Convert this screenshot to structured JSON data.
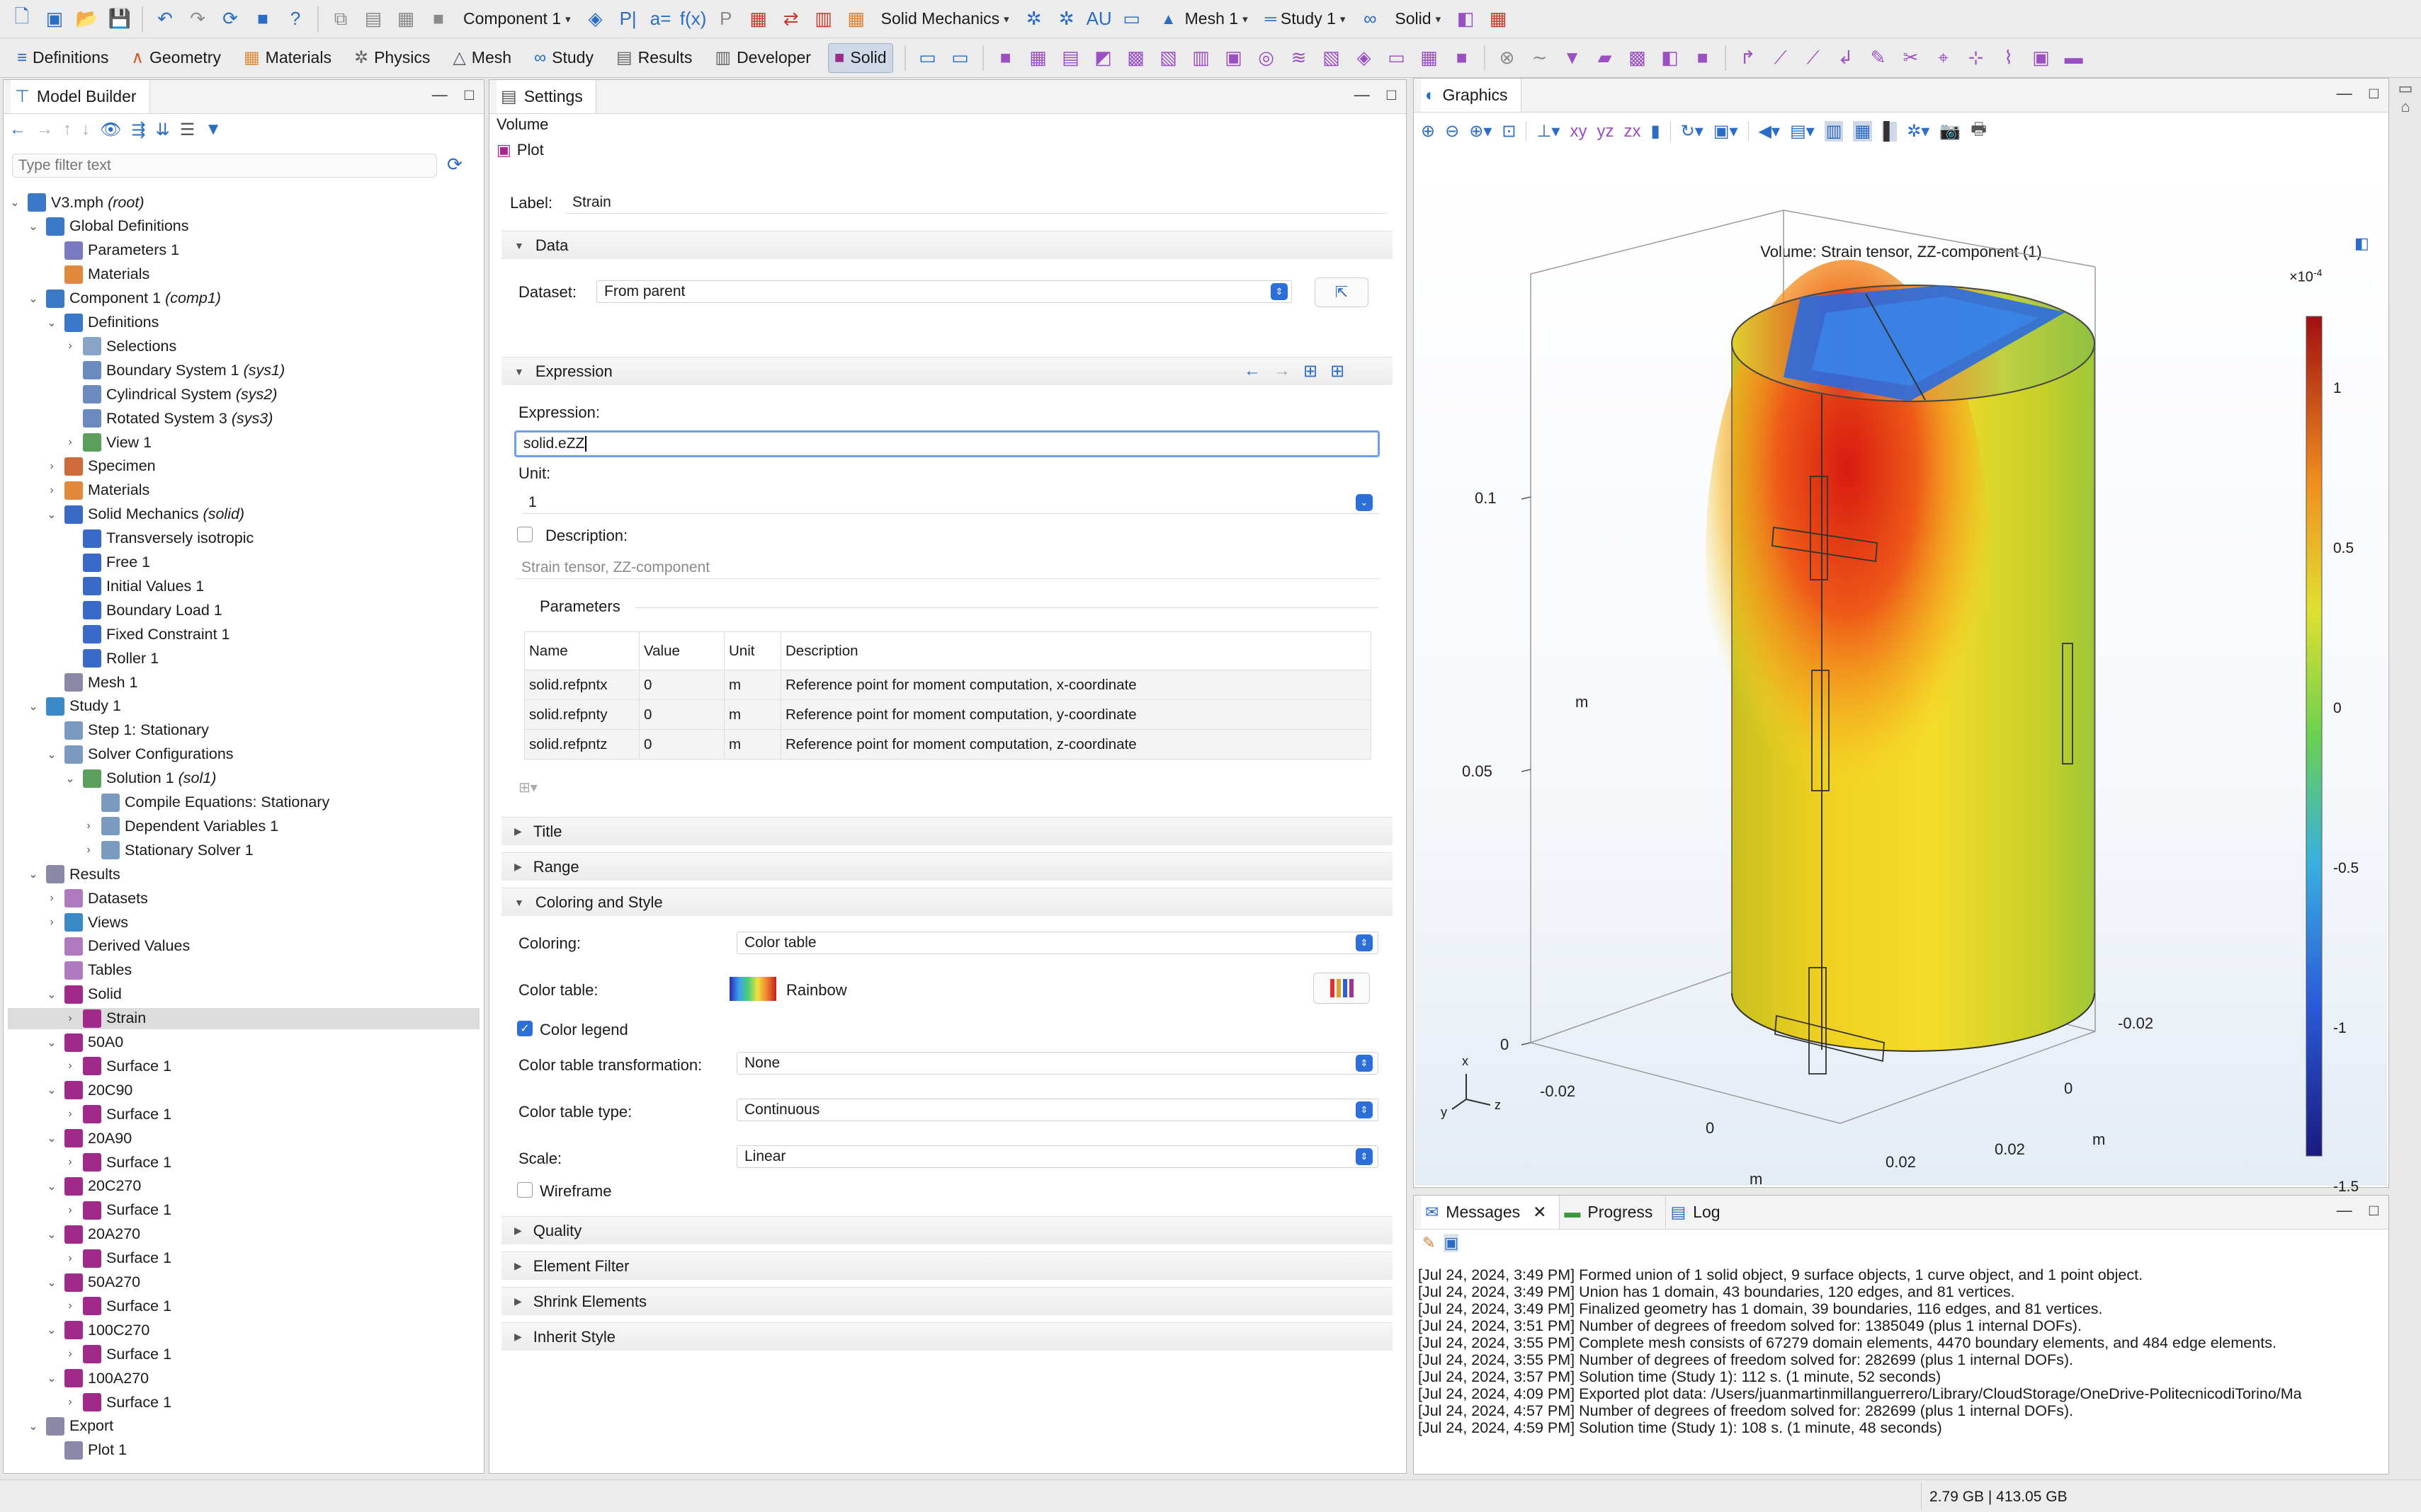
{
  "toolbar": {
    "component_dd": "Component 1",
    "physics_dd": "Solid Mechanics",
    "mesh_dd": "Mesh 1",
    "study_dd": "Study 1",
    "solid_dd": "Solid"
  },
  "ribbon": {
    "tabs": [
      "Definitions",
      "Geometry",
      "Materials",
      "Physics",
      "Mesh",
      "Study",
      "Results",
      "Developer",
      "Solid"
    ],
    "active_tab": "Solid"
  },
  "model_builder": {
    "title": "Model Builder",
    "filter_placeholder": "Type filter text",
    "tree": [
      {
        "label": "V3.mph",
        "italic": "(root)",
        "level": 0,
        "tw": "v",
        "icon": "#3a78c8"
      },
      {
        "label": "Global Definitions",
        "italic": "",
        "level": 1,
        "tw": "v",
        "icon": "#3a78c8"
      },
      {
        "label": "Parameters 1",
        "italic": "",
        "level": 2,
        "tw": "",
        "icon": "#7a7ac0"
      },
      {
        "label": "Materials",
        "italic": "",
        "level": 2,
        "tw": "",
        "icon": "#e08a3a"
      },
      {
        "label": "Component 1",
        "italic": "(comp1)",
        "level": 1,
        "tw": "v",
        "icon": "#3a78c8"
      },
      {
        "label": "Definitions",
        "italic": "",
        "level": 2,
        "tw": "v",
        "icon": "#3a78c8"
      },
      {
        "label": "Selections",
        "italic": "",
        "level": 3,
        "tw": ">",
        "icon": "#8aa4c8"
      },
      {
        "label": "Boundary System 1",
        "italic": "(sys1)",
        "level": 3,
        "tw": "",
        "icon": "#6a8ac0"
      },
      {
        "label": "Cylindrical System",
        "italic": "(sys2)",
        "level": 3,
        "tw": "",
        "icon": "#6a8ac0"
      },
      {
        "label": "Rotated System 3",
        "italic": "(sys3)",
        "level": 3,
        "tw": "",
        "icon": "#6a8ac0"
      },
      {
        "label": "View 1",
        "italic": "",
        "level": 3,
        "tw": ">",
        "icon": "#5aa05a"
      },
      {
        "label": "Specimen",
        "italic": "",
        "level": 2,
        "tw": ">",
        "icon": "#d06a3a"
      },
      {
        "label": "Materials",
        "italic": "",
        "level": 2,
        "tw": ">",
        "icon": "#e08a3a"
      },
      {
        "label": "Solid Mechanics",
        "italic": "(solid)",
        "level": 2,
        "tw": "v",
        "icon": "#3a6ac8"
      },
      {
        "label": "Transversely isotropic",
        "italic": "",
        "level": 3,
        "tw": "",
        "icon": "#3a6ac8"
      },
      {
        "label": "Free 1",
        "italic": "",
        "level": 3,
        "tw": "",
        "icon": "#3a6ac8"
      },
      {
        "label": "Initial Values 1",
        "italic": "",
        "level": 3,
        "tw": "",
        "icon": "#3a6ac8"
      },
      {
        "label": "Boundary Load 1",
        "italic": "",
        "level": 3,
        "tw": "",
        "icon": "#3a6ac8"
      },
      {
        "label": "Fixed Constraint 1",
        "italic": "",
        "level": 3,
        "tw": "",
        "icon": "#3a6ac8"
      },
      {
        "label": "Roller 1",
        "italic": "",
        "level": 3,
        "tw": "",
        "icon": "#3a6ac8"
      },
      {
        "label": "Mesh 1",
        "italic": "",
        "level": 2,
        "tw": "",
        "icon": "#8a8aa8"
      },
      {
        "label": "Study 1",
        "italic": "",
        "level": 1,
        "tw": "v",
        "icon": "#3a8ac8"
      },
      {
        "label": "Step 1: Stationary",
        "italic": "",
        "level": 2,
        "tw": "",
        "icon": "#7a9ac0"
      },
      {
        "label": "Solver Configurations",
        "italic": "",
        "level": 2,
        "tw": "v",
        "icon": "#7a9ac0"
      },
      {
        "label": "Solution 1",
        "italic": "(sol1)",
        "level": 3,
        "tw": "v",
        "icon": "#5aa05a"
      },
      {
        "label": "Compile Equations: Stationary",
        "italic": "",
        "level": 4,
        "tw": "",
        "icon": "#7a9ac0"
      },
      {
        "label": "Dependent Variables 1",
        "italic": "",
        "level": 4,
        "tw": ">",
        "icon": "#7a9ac0"
      },
      {
        "label": "Stationary Solver 1",
        "italic": "",
        "level": 4,
        "tw": ">",
        "icon": "#7a9ac0"
      },
      {
        "label": "Results",
        "italic": "",
        "level": 1,
        "tw": "v",
        "icon": "#8a8aa8"
      },
      {
        "label": "Datasets",
        "italic": "",
        "level": 2,
        "tw": ">",
        "icon": "#b07ac0"
      },
      {
        "label": "Views",
        "italic": "",
        "level": 2,
        "tw": ">",
        "icon": "#3a8ac8"
      },
      {
        "label": "Derived Values",
        "italic": "",
        "level": 2,
        "tw": "",
        "icon": "#b07ac0"
      },
      {
        "label": "Tables",
        "italic": "",
        "level": 2,
        "tw": "",
        "icon": "#b07ac0"
      },
      {
        "label": "Solid",
        "italic": "",
        "level": 2,
        "tw": "v",
        "icon": "#a02a8a"
      },
      {
        "label": "Strain",
        "italic": "",
        "level": 3,
        "tw": ">",
        "icon": "#a02a8a",
        "selected": true
      },
      {
        "label": "50A0",
        "italic": "",
        "level": 2,
        "tw": "v",
        "icon": "#a02a8a"
      },
      {
        "label": "Surface 1",
        "italic": "",
        "level": 3,
        "tw": ">",
        "icon": "#a02a8a"
      },
      {
        "label": "20C90",
        "italic": "",
        "level": 2,
        "tw": "v",
        "icon": "#a02a8a"
      },
      {
        "label": "Surface 1",
        "italic": "",
        "level": 3,
        "tw": ">",
        "icon": "#a02a8a"
      },
      {
        "label": "20A90",
        "italic": "",
        "level": 2,
        "tw": "v",
        "icon": "#a02a8a"
      },
      {
        "label": "Surface 1",
        "italic": "",
        "level": 3,
        "tw": ">",
        "icon": "#a02a8a"
      },
      {
        "label": "20C270",
        "italic": "",
        "level": 2,
        "tw": "v",
        "icon": "#a02a8a"
      },
      {
        "label": "Surface 1",
        "italic": "",
        "level": 3,
        "tw": ">",
        "icon": "#a02a8a"
      },
      {
        "label": "20A270",
        "italic": "",
        "level": 2,
        "tw": "v",
        "icon": "#a02a8a"
      },
      {
        "label": "Surface 1",
        "italic": "",
        "level": 3,
        "tw": ">",
        "icon": "#a02a8a"
      },
      {
        "label": "50A270",
        "italic": "",
        "level": 2,
        "tw": "v",
        "icon": "#a02a8a"
      },
      {
        "label": "Surface 1",
        "italic": "",
        "level": 3,
        "tw": ">",
        "icon": "#a02a8a"
      },
      {
        "label": "100C270",
        "italic": "",
        "level": 2,
        "tw": "v",
        "icon": "#a02a8a"
      },
      {
        "label": "Surface 1",
        "italic": "",
        "level": 3,
        "tw": ">",
        "icon": "#a02a8a"
      },
      {
        "label": "100A270",
        "italic": "",
        "level": 2,
        "tw": "v",
        "icon": "#a02a8a"
      },
      {
        "label": "Surface 1",
        "italic": "",
        "level": 3,
        "tw": ">",
        "icon": "#a02a8a"
      },
      {
        "label": "Export",
        "italic": "",
        "level": 1,
        "tw": "v",
        "icon": "#8a8aa8"
      },
      {
        "label": "Plot 1",
        "italic": "",
        "level": 2,
        "tw": "",
        "icon": "#8a8aa8"
      }
    ]
  },
  "settings": {
    "title": "Settings",
    "type": "Volume",
    "plot_button": "Plot",
    "label_caption": "Label:",
    "label_value": "Strain",
    "data_section": "Data",
    "dataset_caption": "Dataset:",
    "dataset_value": "From parent",
    "expression_section": "Expression",
    "expression_caption": "Expression:",
    "expression_value": "solid.eZZ",
    "unit_caption": "Unit:",
    "unit_value": "1",
    "description_caption": "Description:",
    "description_value": "Strain tensor, ZZ-component",
    "parameters_caption": "Parameters",
    "param_headers": [
      "Name",
      "Value",
      "Unit",
      "Description"
    ],
    "param_rows": [
      [
        "solid.refpntx",
        "0",
        "m",
        "Reference point for moment computation, x-coordinate"
      ],
      [
        "solid.refpnty",
        "0",
        "m",
        "Reference point for moment computation, y-coordinate"
      ],
      [
        "solid.refpntz",
        "0",
        "m",
        "Reference point for moment computation, z-coordinate"
      ]
    ],
    "title_section": "Title",
    "range_section": "Range",
    "coloring_section": "Coloring and Style",
    "coloring_caption": "Coloring:",
    "coloring_value": "Color table",
    "color_table_caption": "Color table:",
    "color_table_value": "Rainbow",
    "color_legend_caption": "Color legend",
    "color_legend_checked": true,
    "ctt_caption": "Color table transformation:",
    "ctt_value": "None",
    "ctype_caption": "Color table type:",
    "ctype_value": "Continuous",
    "scale_caption": "Scale:",
    "scale_value": "Linear",
    "wireframe_caption": "Wireframe",
    "wireframe_checked": false,
    "quality_section": "Quality",
    "element_filter_section": "Element Filter",
    "shrink_section": "Shrink Elements",
    "inherit_section": "Inherit Style"
  },
  "graphics": {
    "title": "Graphics",
    "plot_title": "Volume: Strain tensor, ZZ-component (1)",
    "legend_exponent": "×10",
    "legend_exponent_power": "-4",
    "legend_ticks": [
      "1",
      "0.5",
      "0",
      "-0.5",
      "-1",
      "-1.5"
    ],
    "axis_z_ticks": [
      "0.1",
      "0.05",
      "0"
    ],
    "axis_z_unit": "m",
    "axis_x_ticks": [
      "-0.02",
      "0",
      "0.02"
    ],
    "axis_x_unit": "m",
    "axis_y_ticks": [
      "0.02",
      "0",
      "-0.02"
    ],
    "axis_y_unit": "m",
    "triad": {
      "x": "x",
      "y": "y",
      "z": "z"
    }
  },
  "messages": {
    "tabs": [
      "Messages",
      "Progress",
      "Log"
    ],
    "lines": [
      "[Jul 24, 2024, 3:49 PM] Formed union of 1 solid object, 9 surface objects, 1 curve object, and 1 point object.",
      "[Jul 24, 2024, 3:49 PM] Union has 1 domain, 43 boundaries, 120 edges, and 81 vertices.",
      "[Jul 24, 2024, 3:49 PM] Finalized geometry has 1 domain, 39 boundaries, 116 edges, and 81 vertices.",
      "[Jul 24, 2024, 3:51 PM] Number of degrees of freedom solved for: 1385049 (plus 1 internal DOFs).",
      "[Jul 24, 2024, 3:55 PM] Complete mesh consists of 67279 domain elements, 4470 boundary elements, and 484 edge elements.",
      "[Jul 24, 2024, 3:55 PM] Number of degrees of freedom solved for: 282699 (plus 1 internal DOFs).",
      "[Jul 24, 2024, 3:57 PM] Solution time (Study 1): 112 s. (1 minute, 52 seconds)",
      "[Jul 24, 2024, 4:09 PM] Exported plot data: /Users/juanmartinmillanguerrero/Library/CloudStorage/OneDrive-PolitecnicodiTorino/Ma",
      "[Jul 24, 2024, 4:57 PM] Number of degrees of freedom solved for: 282699 (plus 1 internal DOFs).",
      "[Jul 24, 2024, 4:59 PM] Solution time (Study 1): 108 s. (1 minute, 48 seconds)"
    ]
  },
  "status": {
    "memory": "2.79 GB | 413.05 GB"
  },
  "colors": {
    "accent": "#2d6fd8",
    "selected_row": "#dcdcdc"
  }
}
